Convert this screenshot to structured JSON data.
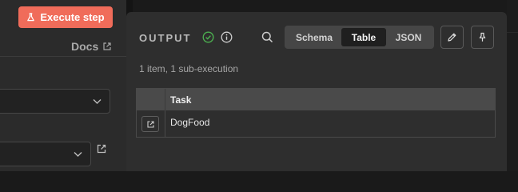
{
  "left_panel": {
    "execute_label": "Execute step",
    "docs_label": "Docs"
  },
  "output": {
    "title": "OUTPUT",
    "summary": "1 item, 1 sub-execution",
    "view_tabs": [
      {
        "label": "Schema",
        "selected": false
      },
      {
        "label": "Table",
        "selected": true
      },
      {
        "label": "JSON",
        "selected": false
      }
    ],
    "table": {
      "columns": [
        "Task"
      ],
      "rows": [
        [
          "DogFood"
        ]
      ]
    }
  },
  "colors": {
    "execute_button": "#f06c5a",
    "success_check": "#4caf50",
    "panel_bg": "#2e2e2e"
  },
  "icons": {
    "execute": "flask-icon",
    "docs": "external-link-icon",
    "status": "check-circle-icon",
    "info": "info-icon",
    "search": "search-icon",
    "edit": "pencil-icon",
    "pin": "pin-icon",
    "row_open": "external-link-icon"
  }
}
